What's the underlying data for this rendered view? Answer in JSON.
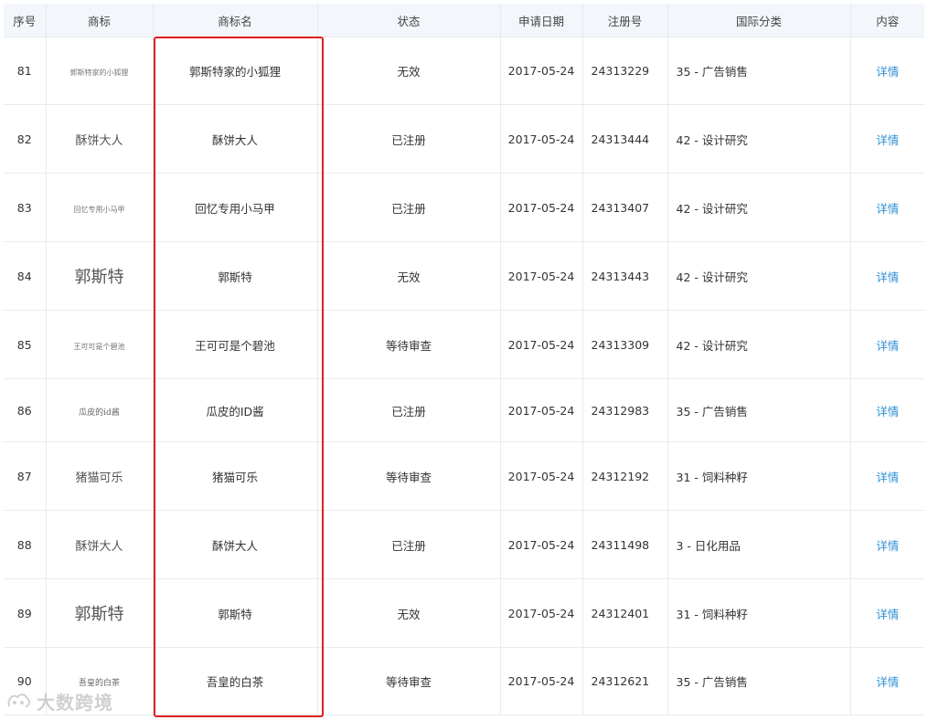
{
  "table": {
    "headers": {
      "index": "序号",
      "mark": "商标",
      "name": "商标名",
      "status": "状态",
      "date": "申请日期",
      "reg": "注册号",
      "class": "国际分类",
      "content": "内容"
    },
    "rows": [
      {
        "index": "81",
        "mark": "郭斯特家的小狐狸",
        "name": "郭斯特家的小狐狸",
        "status": "无效",
        "date": "2017-05-24",
        "reg": "24313229",
        "class": "35 - 广告销售",
        "detail": "详情"
      },
      {
        "index": "82",
        "mark": "酥饼大人",
        "name": "酥饼大人",
        "status": "已注册",
        "date": "2017-05-24",
        "reg": "24313444",
        "class": "42 - 设计研究",
        "detail": "详情"
      },
      {
        "index": "83",
        "mark": "回忆专用小马甲",
        "name": "回忆专用小马甲",
        "status": "已注册",
        "date": "2017-05-24",
        "reg": "24313407",
        "class": "42 - 设计研究",
        "detail": "详情"
      },
      {
        "index": "84",
        "mark": "郭斯特",
        "name": "郭斯特",
        "status": "无效",
        "date": "2017-05-24",
        "reg": "24313443",
        "class": "42 - 设计研究",
        "detail": "详情"
      },
      {
        "index": "85",
        "mark": "王可可是个碧池",
        "name": "王可可是个碧池",
        "status": "等待审查",
        "date": "2017-05-24",
        "reg": "24313309",
        "class": "42 - 设计研究",
        "detail": "详情"
      },
      {
        "index": "86",
        "mark": "瓜皮的id酱",
        "name": "瓜皮的ID酱",
        "status": "已注册",
        "date": "2017-05-24",
        "reg": "24312983",
        "class": "35 - 广告销售",
        "detail": "详情"
      },
      {
        "index": "87",
        "mark": "猪猫可乐",
        "name": "猪猫可乐",
        "status": "等待审查",
        "date": "2017-05-24",
        "reg": "24312192",
        "class": "31 - 饲料种籽",
        "detail": "详情"
      },
      {
        "index": "88",
        "mark": "酥饼大人",
        "name": "酥饼大人",
        "status": "已注册",
        "date": "2017-05-24",
        "reg": "24311498",
        "class": "3 - 日化用品",
        "detail": "详情"
      },
      {
        "index": "89",
        "mark": "郭斯特",
        "name": "郭斯特",
        "status": "无效",
        "date": "2017-05-24",
        "reg": "24312401",
        "class": "31 - 饲料种籽",
        "detail": "详情"
      },
      {
        "index": "90",
        "mark": "吾皇的白茶",
        "name": "吾皇的白茶",
        "status": "等待审查",
        "date": "2017-05-24",
        "reg": "24312621",
        "class": "35 - 广告销售",
        "detail": "详情"
      }
    ]
  },
  "watermark": {
    "text": "大数跨境"
  },
  "colors": {
    "link": "#2d8fd3",
    "highlight": "#e02020",
    "header_bg": "#f3f6fa",
    "border": "#e6ebf1"
  }
}
